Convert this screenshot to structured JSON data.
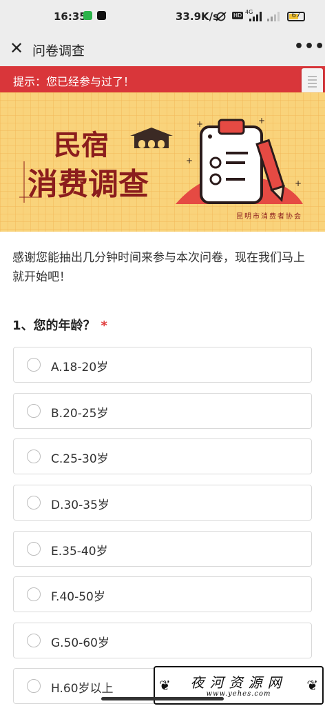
{
  "status_bar": {
    "time": "16:35",
    "network_speed": "33.9K/s",
    "signal_4g": "4G",
    "hd": "HD",
    "battery": "67",
    "battery_level": 0.67
  },
  "nav": {
    "title": "问卷调查",
    "close_icon": "close-icon",
    "more_icon": "more-icon"
  },
  "notice": {
    "text": "提示：您已经参与过了！",
    "color": "#d9363a"
  },
  "banner": {
    "line1": "民宿",
    "line2": "消费调查",
    "org": "昆明市消费者协会",
    "accent": "#8b1d1d",
    "bg": "#f9d37b"
  },
  "intro": "感谢您能抽出几分钟时间来参与本次问卷，现在我们马上就开始吧！",
  "question": {
    "title": "1、您的年龄？",
    "required_mark": "*",
    "options": [
      "A.18-20岁",
      "B.20-25岁",
      "C.25-30岁",
      "D.30-35岁",
      "E.35-40岁",
      "F.40-50岁",
      "G.50-60岁",
      "H.60岁以上"
    ]
  },
  "watermark": {
    "text": "夜河资源网",
    "url": "www.yehes.com"
  }
}
